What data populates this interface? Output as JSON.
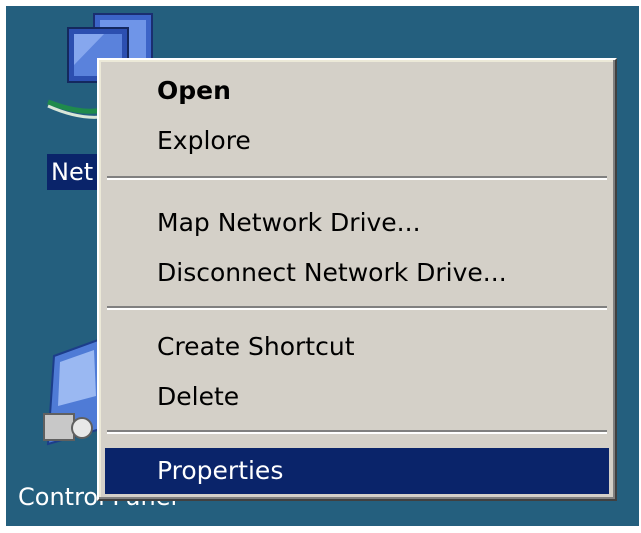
{
  "desktop": {
    "background_color": "#245f7e",
    "icons": [
      {
        "label": "Net",
        "icon": "network-places-icon"
      },
      {
        "label": "Control Panel",
        "icon": "control-panel-icon"
      }
    ]
  },
  "context_menu": {
    "items": [
      {
        "label": "Open",
        "bold": true
      },
      {
        "label": "Explore"
      },
      {
        "label": "Map Network Drive..."
      },
      {
        "label": "Disconnect Network Drive..."
      },
      {
        "label": "Create Shortcut"
      },
      {
        "label": "Delete"
      },
      {
        "label": "Properties",
        "highlighted": true
      }
    ],
    "highlight_color": "#0a246a",
    "menu_color": "#d4d0c8"
  }
}
